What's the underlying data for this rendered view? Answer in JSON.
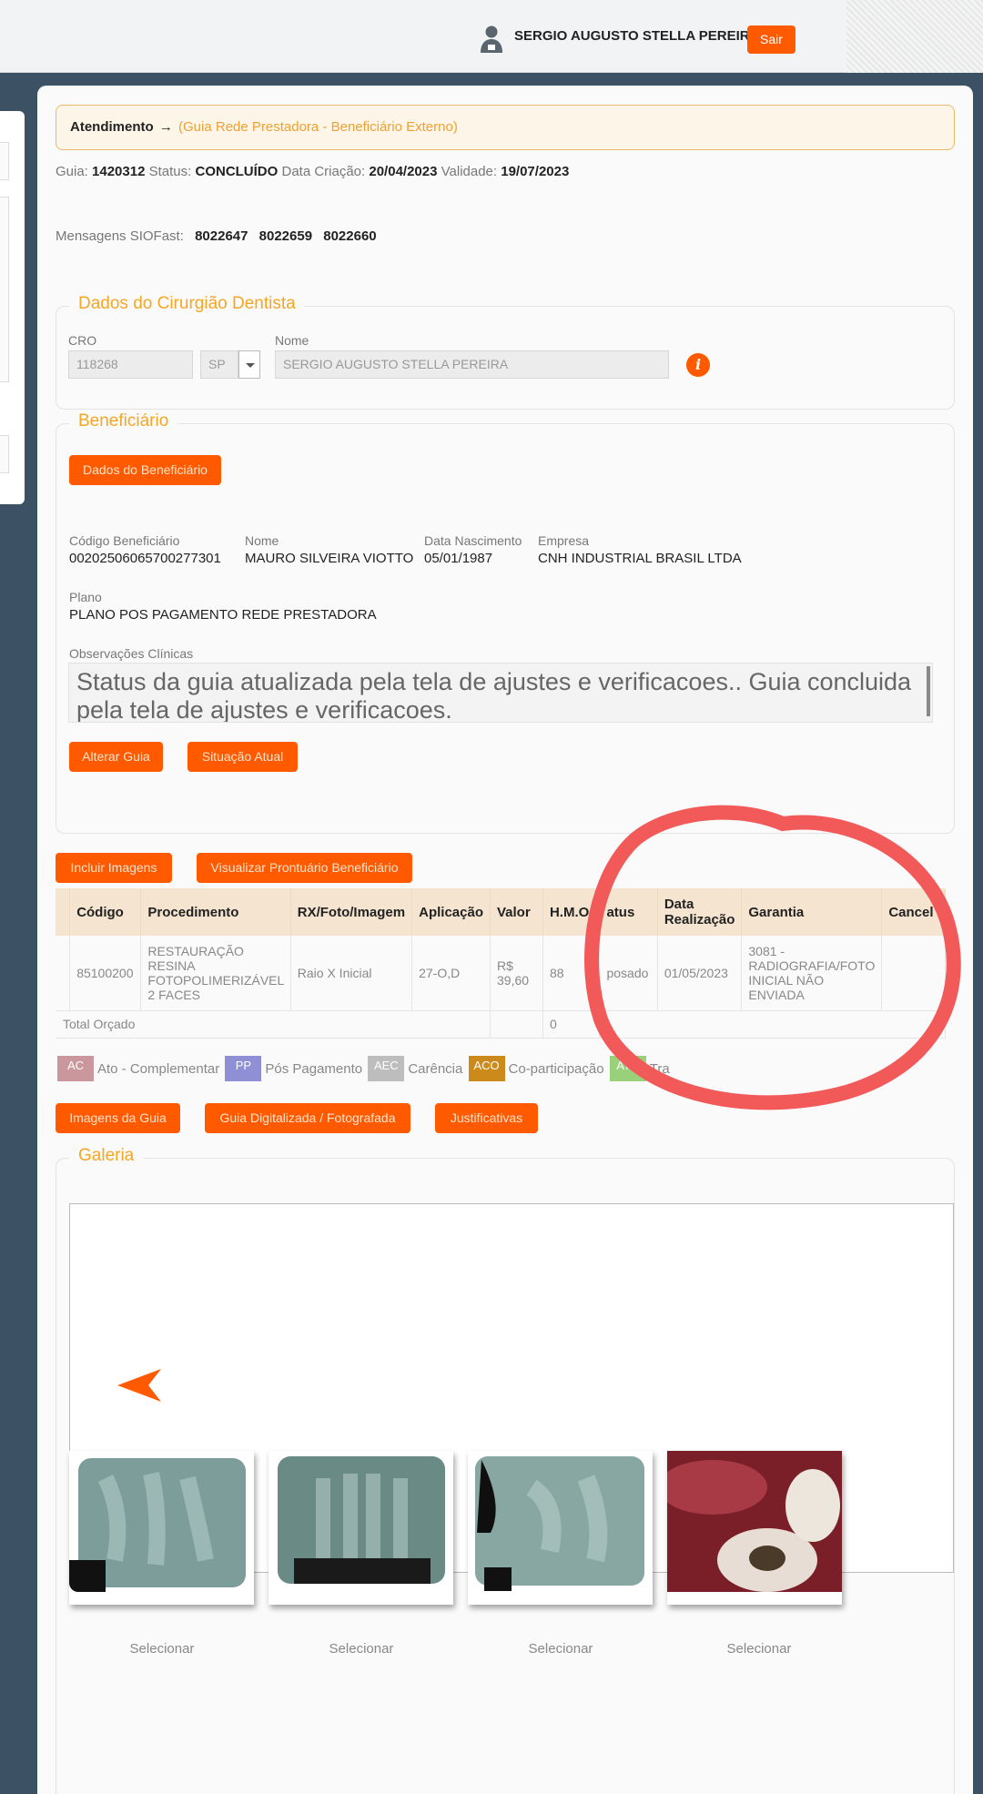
{
  "header": {
    "user_name": "SERGIO AUGUSTO STELLA PEREIRA",
    "logout_label": "Sair",
    "user_icon": "user-icon"
  },
  "breadcrumb": {
    "section": "Atendimento",
    "arrow": "→",
    "page": "(Guia Rede Prestadora - Beneficiário Externo)"
  },
  "guia": {
    "guia_label": "Guia:",
    "guia_value": "1420312",
    "status_label": "Status:",
    "status_value": "CONCLUÍDO",
    "data_criacao_label": "Data Criação:",
    "data_criacao_value": "20/04/2023",
    "validade_label": "Validade:",
    "validade_value": "19/07/2023",
    "mensagens_label": "Mensagens SIOFast:",
    "mensagens": [
      "8022647",
      "8022659",
      "8022660"
    ]
  },
  "dentista": {
    "legend": "Dados do Cirurgião Dentista",
    "cro_label": "CRO",
    "cro_value": "118268",
    "uf_value": "SP",
    "nome_label": "Nome",
    "nome_value": "SERGIO AUGUSTO STELLA PEREIRA",
    "info_icon": "info-icon"
  },
  "beneficiario": {
    "legend": "Beneficiário",
    "dados_button": "Dados do Beneficiário",
    "codigo_label": "Código Beneficiário",
    "codigo_value": "00202506065700277301",
    "nome_label": "Nome",
    "nome_value": "MAURO SILVEIRA VIOTTO",
    "nascimento_label": "Data Nascimento",
    "nascimento_value": "05/01/1987",
    "empresa_label": "Empresa",
    "empresa_value": "CNH INDUSTRIAL BRASIL LTDA",
    "plano_label": "Plano",
    "plano_value": "PLANO POS PAGAMENTO REDE PRESTADORA",
    "obs_label": "Observações Clínicas",
    "obs_value": "Status da guia atualizada pela tela de ajustes e verificacoes.. Guia concluida pela tela de ajustes e verificacoes.",
    "alterar_button": "Alterar Guia",
    "situacao_button": "Situação Atual"
  },
  "actions": {
    "incluir_imagens": "Incluir Imagens",
    "visualizar_prontuario": "Visualizar Prontuário Beneficiário"
  },
  "procedures_table": {
    "headers": [
      "Código",
      "Procedimento",
      "RX/Foto/Imagem",
      "Aplicação",
      "Valor",
      "H.M.O.",
      "Status",
      "Data Realização",
      "Garantia",
      "Cancel"
    ],
    "header_visible": [
      "Código",
      "Procedimento",
      "RX/Foto/Imagem",
      "Aplicação",
      "Valor",
      "H.M.O.",
      "atus",
      "Data Realização",
      "Garantia",
      "Cancel"
    ],
    "rows": [
      [
        "85100200",
        "RESTAURAÇÃO RESINA FOTOPOLIMERIZÁVEL 2 FACES",
        "Raio X Inicial",
        "27-O,D",
        "R$ 39,60",
        "88",
        "posado",
        "01/05/2023",
        "3081 - RADIOGRAFIA/FOTO INICIAL NÃO ENVIADA",
        ""
      ]
    ],
    "total_label": "Total Orçado",
    "total_hmo": "0"
  },
  "legend_chips": [
    {
      "code": "AC",
      "label": "Ato - Complementar",
      "color": "#c9979c"
    },
    {
      "code": "PP",
      "label": "Pós Pagamento",
      "color": "#8f8fd6"
    },
    {
      "code": "AEC",
      "label": "Carência",
      "color": "#bdbdbd"
    },
    {
      "code": "ACO",
      "label": "Co-participação",
      "color": "#cc8a1a"
    },
    {
      "code": "ATR",
      "label": "Tra",
      "color": "#99d17a"
    }
  ],
  "doc_buttons": {
    "imagens_guia": "Imagens da Guia",
    "guia_digitalizada": "Guia Digitalizada / Fotografada",
    "justificativas": "Justificativas"
  },
  "gallery": {
    "legend": "Galeria",
    "prev_icon": "chevron-left-icon",
    "thumbs": [
      {
        "select_label": "Selecionar"
      },
      {
        "select_label": "Selecionar"
      },
      {
        "select_label": "Selecionar"
      },
      {
        "select_label": "Selecionar"
      }
    ]
  },
  "colors": {
    "accent": "#ff5a00",
    "legend_text": "#f5a623",
    "background": "#3c5163",
    "annotation": "#f25a5a"
  }
}
